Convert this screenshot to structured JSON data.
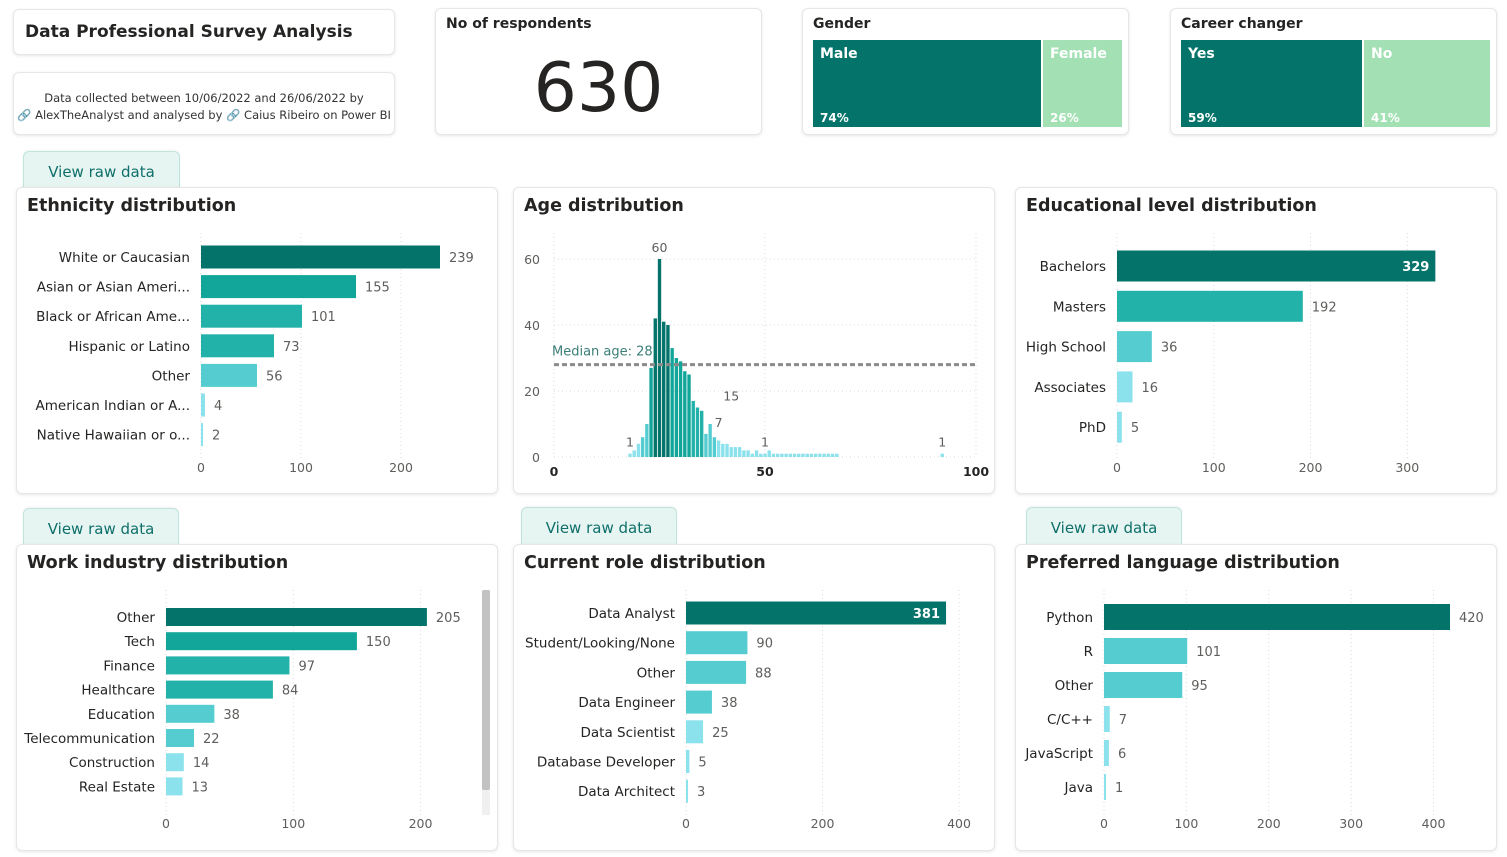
{
  "header": {
    "title": "Data Professional Survey Analysis",
    "info_line1": "Data collected between 10/06/2022 and 26/06/2022 by",
    "info_line2": "🔗 AlexTheAnalyst and analysed by 🔗 Caius Ribeiro on Power BI"
  },
  "kpi": {
    "label": "No of respondents",
    "value": "630"
  },
  "gender": {
    "label": "Gender",
    "cells": [
      {
        "name": "Male",
        "pct": "74%",
        "fraction": 0.74,
        "color": "#04746b"
      },
      {
        "name": "Female",
        "pct": "26%",
        "fraction": 0.26,
        "color": "#a3e0b3"
      }
    ]
  },
  "career": {
    "label": "Career changer",
    "cells": [
      {
        "name": "Yes",
        "pct": "59%",
        "fraction": 0.59,
        "color": "#04746b"
      },
      {
        "name": "No",
        "pct": "41%",
        "fraction": 0.41,
        "color": "#a3e0b3"
      }
    ]
  },
  "tabs": {
    "view_raw": "View raw data"
  },
  "colors": {
    "dark": "#04746b",
    "mid": "#12a69b",
    "teal": "#22b2aa",
    "light": "#55cdd0",
    "pale": "#8ce2ec",
    "ref": "#8a8a8a"
  },
  "chart_data": [
    {
      "id": "ethnicity",
      "type": "bar",
      "title": "Ethnicity distribution",
      "categories": [
        "White or Caucasian",
        "Asian or Asian Ameri...",
        "Black or African Ame...",
        "Hispanic or Latino",
        "Other",
        "American Indian or A...",
        "Native Hawaiian or o..."
      ],
      "values": [
        239,
        155,
        101,
        73,
        56,
        4,
        2
      ],
      "xticks": [
        0,
        100,
        200
      ],
      "xlim": [
        0,
        250
      ],
      "label_inside": [
        false,
        false,
        false,
        false,
        false,
        false,
        false
      ]
    },
    {
      "id": "age",
      "type": "bar",
      "title": "Age distribution",
      "x": [
        18,
        19,
        20,
        21,
        22,
        23,
        24,
        25,
        26,
        27,
        28,
        29,
        30,
        31,
        32,
        33,
        34,
        35,
        36,
        37,
        38,
        39,
        40,
        41,
        42,
        43,
        44,
        45,
        46,
        47,
        48,
        49,
        50,
        51,
        52,
        53,
        54,
        55,
        56,
        57,
        58,
        59,
        60,
        61,
        62,
        63,
        64,
        65,
        66,
        67,
        92
      ],
      "values": [
        1,
        2,
        4,
        6,
        10,
        27,
        42,
        60,
        41,
        40,
        33,
        30,
        29,
        26,
        25,
        17,
        15,
        14,
        7,
        10,
        6,
        5,
        4,
        4,
        3,
        3,
        3,
        2,
        2,
        1,
        2,
        1,
        1,
        2,
        1,
        1,
        1,
        1,
        1,
        1,
        1,
        1,
        1,
        1,
        1,
        1,
        1,
        1,
        1,
        1,
        1
      ],
      "peak_values": [
        60,
        15,
        7,
        1,
        1,
        1
      ],
      "peak_x": [
        25,
        42,
        39,
        18,
        50,
        92
      ],
      "xticks": [
        0,
        50,
        100
      ],
      "yticks": [
        0,
        20,
        40,
        60
      ],
      "xlim": [
        0,
        100
      ],
      "ylim": [
        0,
        60
      ],
      "reference_line": {
        "label": "Median age: 28",
        "value": 28
      }
    },
    {
      "id": "education",
      "type": "bar",
      "title": "Educational level distribution",
      "categories": [
        "Bachelors",
        "Masters",
        "High School",
        "Associates",
        "PhD"
      ],
      "values": [
        329,
        192,
        36,
        16,
        5
      ],
      "xticks": [
        0,
        100,
        200,
        300
      ],
      "xlim": [
        0,
        340
      ],
      "label_inside": [
        true,
        false,
        false,
        false,
        false
      ]
    },
    {
      "id": "industry",
      "type": "bar",
      "title": "Work industry distribution",
      "categories": [
        "Other",
        "Tech",
        "Finance",
        "Healthcare",
        "Education",
        "Telecommunication",
        "Construction",
        "Real Estate"
      ],
      "values": [
        205,
        150,
        97,
        84,
        38,
        22,
        14,
        13
      ],
      "xticks": [
        0,
        100,
        200
      ],
      "xlim": [
        0,
        220
      ],
      "label_inside": [
        false,
        false,
        false,
        false,
        false,
        false,
        false,
        false
      ]
    },
    {
      "id": "role",
      "type": "bar",
      "title": "Current role distribution",
      "categories": [
        "Data Analyst",
        "Student/Looking/None",
        "Other",
        "Data Engineer",
        "Data Scientist",
        "Database Developer",
        "Data Architect"
      ],
      "values": [
        381,
        90,
        88,
        38,
        25,
        5,
        3
      ],
      "xticks": [
        0,
        200,
        400
      ],
      "xlim": [
        0,
        400
      ],
      "label_inside": [
        true,
        false,
        false,
        false,
        false,
        false,
        false
      ]
    },
    {
      "id": "language",
      "type": "bar",
      "title": "Preferred language distribution",
      "categories": [
        "Python",
        "R",
        "Other",
        "C/C++",
        "JavaScript",
        "Java"
      ],
      "values": [
        420,
        101,
        95,
        7,
        6,
        1
      ],
      "xticks": [
        0,
        100,
        200,
        300,
        400
      ],
      "xlim": [
        0,
        420
      ],
      "label_inside": [
        false,
        false,
        false,
        false,
        false,
        false
      ]
    }
  ]
}
